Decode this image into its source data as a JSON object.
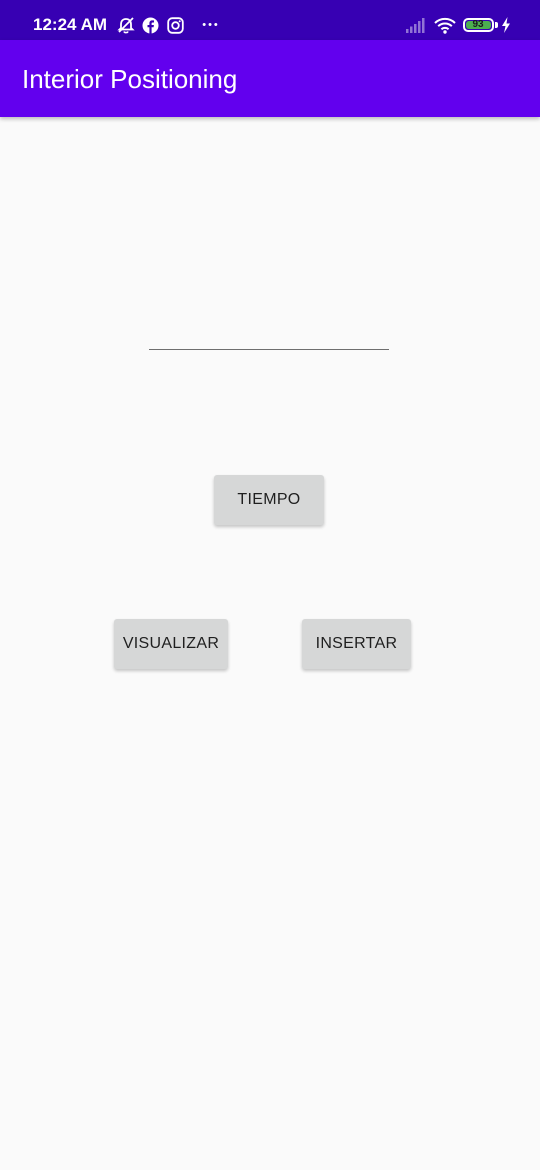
{
  "status_bar": {
    "time": "12:24 AM",
    "battery_level": "93",
    "background_color": "#3700b3",
    "battery_color": "#4caf50",
    "icons": [
      "alarm-off-icon",
      "facebook-icon",
      "instagram-icon",
      "more-dots-icon",
      "signal-icon",
      "wifi-icon",
      "battery-icon",
      "charging-icon"
    ],
    "more_glyph": "•••"
  },
  "app_bar": {
    "title": "Interior Positioning",
    "background_color": "#6200ee"
  },
  "input": {
    "value": "",
    "placeholder": ""
  },
  "buttons": {
    "tiempo": "TIEMPO",
    "visualizar": "VISUALIZAR",
    "insertar": "INSERTAR"
  }
}
